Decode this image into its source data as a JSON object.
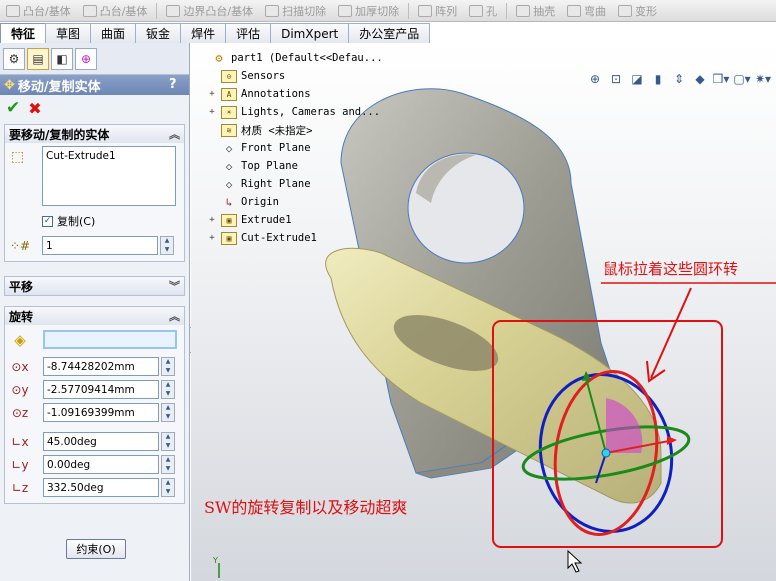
{
  "toolbar": {
    "items": [
      "凸台/基体",
      "凸台/基体",
      "边界凸台/基体",
      "扫描切除",
      "加厚切除",
      "阵列",
      "孔",
      "抽壳",
      "弯曲",
      "变形"
    ]
  },
  "tabs": [
    {
      "label": "特征",
      "active": true
    },
    {
      "label": "草图",
      "active": false
    },
    {
      "label": "曲面",
      "active": false
    },
    {
      "label": "钣金",
      "active": false
    },
    {
      "label": "焊件",
      "active": false
    },
    {
      "label": "评估",
      "active": false
    },
    {
      "label": "DimXpert",
      "active": false
    },
    {
      "label": "办公室产品",
      "active": false
    }
  ],
  "panel": {
    "title": "移动/复制实体",
    "help": "?",
    "ok_icon": "check-icon",
    "cancel_icon": "cross-icon",
    "bodies_group": {
      "title": "要移动/复制的实体",
      "list_item": "Cut-Extrude1",
      "copy_label": "复制(C)",
      "copy_checked": true,
      "copies_value": "1"
    },
    "translate_group": {
      "title": "平移"
    },
    "rotate_group": {
      "title": "旋转",
      "x_point": "-8.74428202mm",
      "y_point": "-2.57709414mm",
      "z_point": "-1.09169399mm",
      "x_angle": "45.00deg",
      "y_angle": "0.00deg",
      "z_angle": "332.50deg"
    },
    "constraint_button": "约束(O)"
  },
  "tree": {
    "root": "part1  (Default<<Defau...",
    "items": [
      {
        "label": "Sensors",
        "expandable": false,
        "icon": "sensor-icon"
      },
      {
        "label": "Annotations",
        "expandable": true,
        "icon": "annotation-icon"
      },
      {
        "label": "Lights, Cameras and...",
        "expandable": true,
        "icon": "lights-icon"
      },
      {
        "label": "材质 <未指定>",
        "expandable": false,
        "icon": "material-icon"
      },
      {
        "label": "Front Plane",
        "expandable": false,
        "icon": "plane-icon"
      },
      {
        "label": "Top Plane",
        "expandable": false,
        "icon": "plane-icon"
      },
      {
        "label": "Right Plane",
        "expandable": false,
        "icon": "plane-icon"
      },
      {
        "label": "Origin",
        "expandable": false,
        "icon": "origin-icon"
      },
      {
        "label": "Extrude1",
        "expandable": true,
        "icon": "feature-icon"
      },
      {
        "label": "Cut-Extrude1",
        "expandable": true,
        "icon": "feature-icon"
      }
    ]
  },
  "annotations": {
    "drag_hint": "鼠标拉着这些圆环转",
    "caption": "SW的旋转复制以及移动超爽"
  },
  "colors": {
    "annotation_red": "#e01010",
    "panel_title": "#6d87b6",
    "ring_red": "#e02020",
    "ring_blue": "#1020c0",
    "ring_green": "#1a8a1a"
  }
}
